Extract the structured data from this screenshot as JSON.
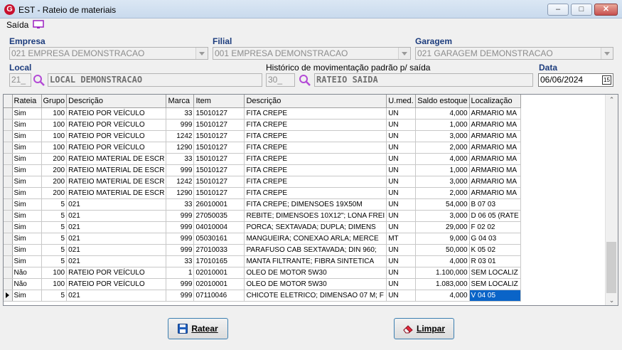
{
  "window": {
    "title": "EST - Rateio de materiais",
    "app_icon": "G"
  },
  "menu": {
    "saida": "Saída"
  },
  "labels": {
    "empresa": "Empresa",
    "filial": "Filial",
    "garagem": "Garagem",
    "local": "Local",
    "historico": "Histórico de movimentação padrão p/ saída",
    "data": "Data"
  },
  "fields": {
    "empresa": "021 EMPRESA DEMONSTRACAO",
    "filial": "001 EMPRESA DEMONSTRACAO",
    "garagem": "021 GARAGEM DEMONSTRACAO",
    "local_code": "21_",
    "local_name": "LOCAL DEMONSTRACAO",
    "historico_code": "30_",
    "historico_name": "RATEIO SAIDA",
    "data": "06/06/2024",
    "calendar": "15"
  },
  "table": {
    "columns": [
      "Rateia",
      "Grupo",
      "Descrição",
      "Marca",
      "Item",
      "Descrição",
      "U.med.",
      "Saldo estoque",
      "Localização"
    ],
    "rows": [
      [
        "Sim",
        "100",
        "RATEIO POR VEÍCULO",
        "33",
        "15010127",
        "FITA CREPE",
        "UN",
        "4,000",
        "ARMARIO MA"
      ],
      [
        "Sim",
        "100",
        "RATEIO POR VEÍCULO",
        "999",
        "15010127",
        "FITA CREPE",
        "UN",
        "1,000",
        "ARMARIO MA"
      ],
      [
        "Sim",
        "100",
        "RATEIO POR VEÍCULO",
        "1242",
        "15010127",
        "FITA CREPE",
        "UN",
        "3,000",
        "ARMARIO MA"
      ],
      [
        "Sim",
        "100",
        "RATEIO POR VEÍCULO",
        "1290",
        "15010127",
        "FITA CREPE",
        "UN",
        "2,000",
        "ARMARIO MA"
      ],
      [
        "Sim",
        "200",
        "RATEIO MATERIAL DE ESCR",
        "33",
        "15010127",
        "FITA CREPE",
        "UN",
        "4,000",
        "ARMARIO MA"
      ],
      [
        "Sim",
        "200",
        "RATEIO MATERIAL DE ESCR",
        "999",
        "15010127",
        "FITA CREPE",
        "UN",
        "1,000",
        "ARMARIO MA"
      ],
      [
        "Sim",
        "200",
        "RATEIO MATERIAL DE ESCR",
        "1242",
        "15010127",
        "FITA CREPE",
        "UN",
        "3,000",
        "ARMARIO MA"
      ],
      [
        "Sim",
        "200",
        "RATEIO MATERIAL DE ESCR",
        "1290",
        "15010127",
        "FITA CREPE",
        "UN",
        "2,000",
        "ARMARIO MA"
      ],
      [
        "Sim",
        "5",
        "021",
        "33",
        "26010001",
        "FITA CREPE; DIMENSOES 19X50M",
        "UN",
        "54,000",
        "B 07 03"
      ],
      [
        "Sim",
        "5",
        "021",
        "999",
        "27050035",
        "REBITE; DIMENSOES 10X12\"; LONA FREI",
        "UN",
        "3,000",
        "D 06 05 (RATE"
      ],
      [
        "Sim",
        "5",
        "021",
        "999",
        "04010004",
        "PORCA; SEXTAVADA; DUPLA; DIMENS",
        "UN",
        "29,000",
        "F 02 02"
      ],
      [
        "Sim",
        "5",
        "021",
        "999",
        "05030161",
        "MANGUEIRA; CONEXAO ARLA; MERCE",
        "MT",
        "9,000",
        "G 04 03"
      ],
      [
        "Sim",
        "5",
        "021",
        "999",
        "27010033",
        "PARAFUSO CAB SEXTAVADA; DIN 960;",
        "UN",
        "50,000",
        "K 05 02"
      ],
      [
        "Sim",
        "5",
        "021",
        "33",
        "17010165",
        "MANTA FILTRANTE; FIBRA SINTETICA",
        "UN",
        "4,000",
        "R 03 01"
      ],
      [
        "Não",
        "100",
        "RATEIO POR VEÍCULO",
        "1",
        "02010001",
        "OLEO DE MOTOR 5W30",
        "UN",
        "1.100,000",
        "SEM LOCALIZ"
      ],
      [
        "Não",
        "100",
        "RATEIO POR VEÍCULO",
        "999",
        "02010001",
        "OLEO DE MOTOR 5W30",
        "UN",
        "1.083,000",
        "SEM LOCALIZ"
      ],
      [
        "Sim",
        "5",
        "021",
        "999",
        "07110046",
        "CHICOTE ELETRICO; DIMENSAO 07 M; F",
        "UN",
        "4,000",
        "V 04 05"
      ]
    ]
  },
  "buttons": {
    "ratear": "Ratear",
    "limpar": "Limpar"
  },
  "colors": {
    "label_blue": "#1c3c7d",
    "selection": "#0a64c8",
    "button_border": "#3c7fb1"
  }
}
